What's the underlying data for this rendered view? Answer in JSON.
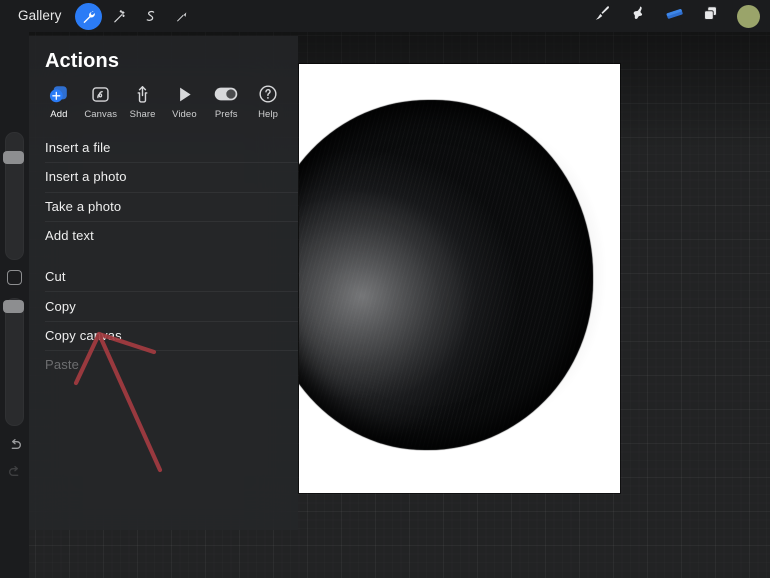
{
  "topbar": {
    "gallery_label": "Gallery",
    "left_tools": [
      {
        "name": "wrench-icon",
        "label": "Actions",
        "active": true
      },
      {
        "name": "magic-wand-icon",
        "label": "Adjustments",
        "active": false
      },
      {
        "name": "s-curve-icon",
        "label": "Selection",
        "active": false
      },
      {
        "name": "arrow-transform-icon",
        "label": "Transform",
        "active": false
      }
    ],
    "right_tools": [
      {
        "name": "paintbrush-icon",
        "label": "Paint"
      },
      {
        "name": "smudge-icon",
        "label": "Smudge"
      },
      {
        "name": "eraser-icon",
        "label": "Erase"
      },
      {
        "name": "layers-icon",
        "label": "Layers"
      }
    ],
    "color_swatch": "#9aa46a",
    "accent_color": "#2b7cf6"
  },
  "rail": {
    "brush_size_slider": {
      "name": "brush-size-slider",
      "value_pct": 88
    },
    "modify_button": {
      "name": "modify-button"
    },
    "opacity_slider": {
      "name": "opacity-slider",
      "value_pct": 100
    },
    "undo_button": {
      "name": "undo-button"
    },
    "redo_button": {
      "name": "redo-button"
    }
  },
  "panel": {
    "title": "Actions",
    "tabs": [
      {
        "label": "Add",
        "icon": "add-plus-icon",
        "active": true
      },
      {
        "label": "Canvas",
        "icon": "canvas-icon",
        "active": false
      },
      {
        "label": "Share",
        "icon": "share-upload-icon",
        "active": false
      },
      {
        "label": "Video",
        "icon": "video-play-icon",
        "active": false
      },
      {
        "label": "Prefs",
        "icon": "toggle-switch-icon",
        "active": false
      },
      {
        "label": "Help",
        "icon": "question-mark-icon",
        "active": false
      }
    ],
    "menu_groups": [
      {
        "items": [
          {
            "label": "Insert a file",
            "disabled": false
          },
          {
            "label": "Insert a photo",
            "disabled": false
          },
          {
            "label": "Take a photo",
            "disabled": false
          },
          {
            "label": "Add text",
            "disabled": false
          }
        ]
      },
      {
        "items": [
          {
            "label": "Cut",
            "disabled": false
          },
          {
            "label": "Copy",
            "disabled": false
          },
          {
            "label": "Copy canvas",
            "disabled": false
          },
          {
            "label": "Paste",
            "disabled": true
          }
        ]
      }
    ]
  },
  "annotation": {
    "name": "red-arrow-annotation",
    "color": "#a33b41",
    "points_to": "Copy canvas"
  },
  "artwork": {
    "name": "ink-blob-artwork",
    "background": "#ffffff",
    "ink_color": "#111111"
  }
}
